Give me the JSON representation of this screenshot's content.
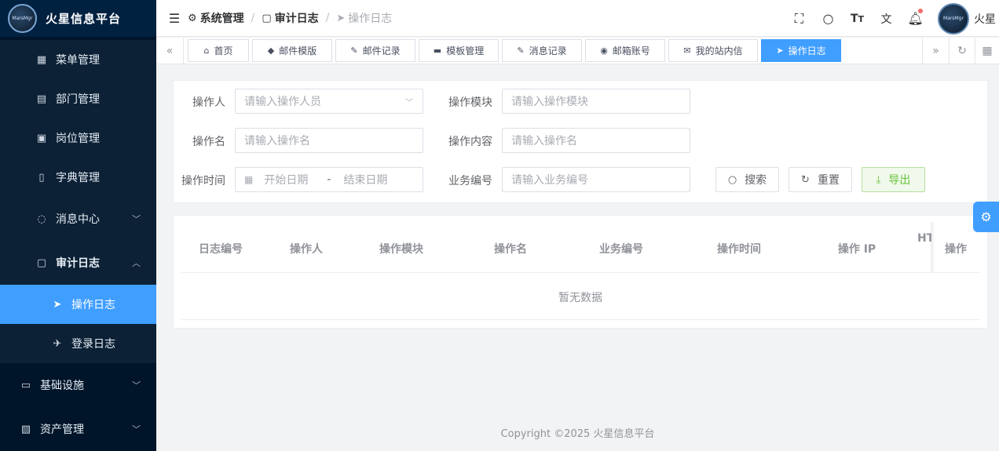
{
  "app": {
    "title": "火星信息平台",
    "logo_text": "MarsMgr"
  },
  "sidebar": {
    "items": [
      {
        "label": "菜单管理",
        "icon": "grid-icon"
      },
      {
        "label": "部门管理",
        "icon": "id-card-icon"
      },
      {
        "label": "岗位管理",
        "icon": "badge-icon"
      },
      {
        "label": "字典管理",
        "icon": "book-icon"
      },
      {
        "label": "消息中心",
        "icon": "chat-icon"
      },
      {
        "label": "审计日志",
        "icon": "document-icon"
      },
      {
        "label": "操作日志",
        "icon": "send-icon"
      },
      {
        "label": "登录日志",
        "icon": "paper-plane-icon"
      },
      {
        "label": "基础设施",
        "icon": "monitor-icon"
      },
      {
        "label": "资产管理",
        "icon": "asset-icon"
      }
    ]
  },
  "breadcrumb": {
    "level1": "系统管理",
    "level2": "审计日志",
    "level3": "操作日志"
  },
  "header": {
    "username": "火星"
  },
  "tags": [
    {
      "label": "首页",
      "icon": "home-icon"
    },
    {
      "label": "邮件模版",
      "icon": "tag-icon"
    },
    {
      "label": "邮件记录",
      "icon": "edit-icon"
    },
    {
      "label": "模板管理",
      "icon": "box-icon"
    },
    {
      "label": "消息记录",
      "icon": "edit-icon"
    },
    {
      "label": "邮箱账号",
      "icon": "at-icon"
    },
    {
      "label": "我的站内信",
      "icon": "mail-icon"
    },
    {
      "label": "操作日志",
      "icon": "send-icon"
    }
  ],
  "search": {
    "operator_label": "操作人",
    "operator_placeholder": "请输入操作人员",
    "module_label": "操作模块",
    "module_placeholder": "请输入操作模块",
    "name_label": "操作名",
    "name_placeholder": "请输入操作名",
    "content_label": "操作内容",
    "content_placeholder": "请输入操作名",
    "time_label": "操作时间",
    "start_placeholder": "开始日期",
    "range_sep": "-",
    "end_placeholder": "结束日期",
    "biz_label": "业务编号",
    "biz_placeholder": "请输入业务编号",
    "search_btn": "搜索",
    "reset_btn": "重置",
    "export_btn": "导出"
  },
  "table": {
    "columns": [
      "日志编号",
      "操作人",
      "操作模块",
      "操作名",
      "业务编号",
      "操作时间",
      "操作 IP",
      "HT",
      "操作"
    ],
    "empty_text": "暂无数据"
  },
  "footer": {
    "text": "Copyright ©2025 火星信息平台"
  },
  "colors": {
    "sidebar": "#001529",
    "accent": "#409eff",
    "export": "#67c23a"
  }
}
